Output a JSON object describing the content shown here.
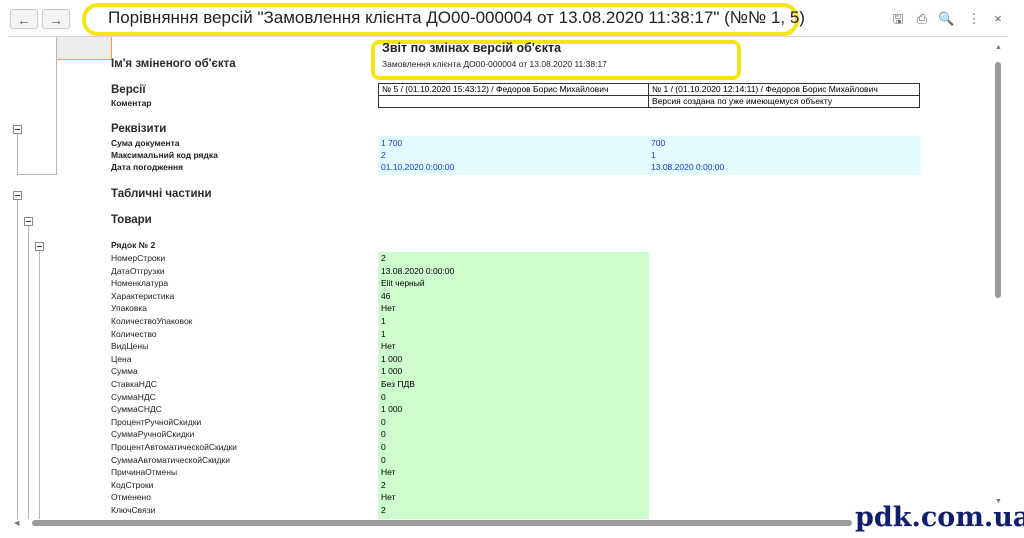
{
  "window": {
    "title": "Порівняння версій \"Замовлення клієнта ДО00-000004 от 13.08.2020 11:38:17\" (№№ 1, 5)",
    "nav": {
      "back": "←",
      "forward": "→"
    },
    "icons": [
      "save-icon",
      "print-icon",
      "preview-icon",
      "more-icon",
      "close-icon"
    ],
    "glyphs": {
      "save": "🖫",
      "print": "⎙",
      "preview": "🔍",
      "more": "⋮",
      "close": "×"
    }
  },
  "report": {
    "object_name_label": "Ім'я зміненого об'єкта",
    "title": "Звіт по змінах версій об'єкта",
    "subtitle": "Замовлення клієнта ДО00-000004 от 13.08.2020 11:38:17",
    "versions_label": "Версії",
    "comment_label": "Коментар",
    "version_a": "№ 5 / (01.10.2020 15:43:12) / Федоров Борис Михайлович",
    "version_b": "№ 1 / (01.10.2020 12:14:11) / Федоров Борис Михайлович",
    "comment_a": "",
    "comment_b": "Версия создана по уже имеющемуся объекту",
    "attributes_label": "Реквізити",
    "attributes": [
      {
        "name": "Сума документа",
        "a": "1 700",
        "b": "700"
      },
      {
        "name": "Максимальний код рядка",
        "a": "2",
        "b": "1"
      },
      {
        "name": "Дата погодження",
        "a": "01.10.2020 0:00:00",
        "b": "13.08.2020 0:00:00"
      }
    ],
    "tables_label": "Табличні частини",
    "goods_label": "Товари",
    "row_label": "Рядок № 2",
    "row_fields": [
      {
        "name": "НомерСтроки",
        "value": "2"
      },
      {
        "name": "ДатаОтгрузки",
        "value": "13.08.2020 0:00:00"
      },
      {
        "name": "Номенклатура",
        "value": "Elit черный"
      },
      {
        "name": "Характеристика",
        "value": "46"
      },
      {
        "name": "Упаковка",
        "value": "Нет"
      },
      {
        "name": "КоличествоУпаковок",
        "value": "1"
      },
      {
        "name": "Количество",
        "value": "1"
      },
      {
        "name": "ВидЦены",
        "value": "Нет"
      },
      {
        "name": "Цена",
        "value": "1 000"
      },
      {
        "name": "Сумма",
        "value": "1 000"
      },
      {
        "name": "СтавкаНДС",
        "value": "Без ПДВ"
      },
      {
        "name": "СуммаНДС",
        "value": "0"
      },
      {
        "name": "СуммаСНДС",
        "value": "1 000"
      },
      {
        "name": "ПроцентРучнойСкидки",
        "value": "0"
      },
      {
        "name": "СуммаРучнойСкидки",
        "value": "0"
      },
      {
        "name": "ПроцентАвтоматическойСкидки",
        "value": "0"
      },
      {
        "name": "СуммаАвтоматическойСкидки",
        "value": "0"
      },
      {
        "name": "ПричинаОтмены",
        "value": "Нет"
      },
      {
        "name": "КодСтроки",
        "value": "2"
      },
      {
        "name": "Отменено",
        "value": "Нет"
      },
      {
        "name": "КлючСвязи",
        "value": "2"
      }
    ]
  },
  "watermark": "pdk.com.ua",
  "colors": {
    "highlight": "#f5e417",
    "changed_bg": "#e1fbff",
    "added_bg": "#cdfccd",
    "changed_text": "#1a3ccc"
  }
}
